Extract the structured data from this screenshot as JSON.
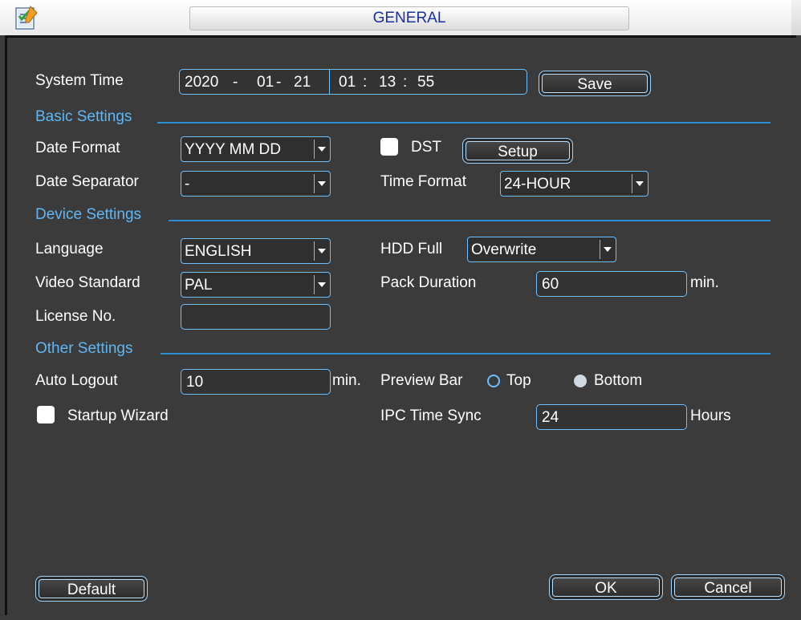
{
  "window": {
    "title": "GENERAL",
    "app_icon": "settings-checklist-icon"
  },
  "system_time": {
    "label": "System Time",
    "year": "2020",
    "sep1": "-",
    "month": "01",
    "sep2": "-",
    "day": "21",
    "hour": "01",
    "colon1": ":",
    "minute": "13",
    "colon2": ":",
    "second": "55",
    "save_label": "Save"
  },
  "basic_settings": {
    "heading": "Basic Settings",
    "date_format_label": "Date Format",
    "date_format_value": "YYYY MM DD",
    "dst_label": "DST",
    "dst_checked": false,
    "setup_label": "Setup",
    "date_separator_label": "Date Separator",
    "date_separator_value": "-",
    "time_format_label": "Time Format",
    "time_format_value": "24-HOUR"
  },
  "device_settings": {
    "heading": "Device Settings",
    "language_label": "Language",
    "language_value": "ENGLISH",
    "hdd_full_label": "HDD Full",
    "hdd_full_value": "Overwrite",
    "video_standard_label": "Video Standard",
    "video_standard_value": "PAL",
    "pack_duration_label": "Pack Duration",
    "pack_duration_value": "60",
    "pack_duration_unit": "min.",
    "license_label": "License No.",
    "license_value": ""
  },
  "other_settings": {
    "heading": "Other Settings",
    "auto_logout_label": "Auto Logout",
    "auto_logout_value": "10",
    "auto_logout_unit": "min.",
    "preview_bar_label": "Preview Bar",
    "preview_bar_options": [
      "Top",
      "Bottom"
    ],
    "preview_bar_selected": "Bottom",
    "startup_wizard_label": "Startup Wizard",
    "startup_wizard_checked": false,
    "ipc_time_sync_label": "IPC Time Sync",
    "ipc_time_sync_value": "24",
    "ipc_time_sync_unit": "Hours"
  },
  "footer": {
    "default_label": "Default",
    "ok_label": "OK",
    "cancel_label": "Cancel"
  },
  "colors": {
    "background": "#3b3b3b",
    "section_heading": "#5fb7f5",
    "field_border": "#6cc0ff",
    "title_text": "#1a2fa0"
  }
}
